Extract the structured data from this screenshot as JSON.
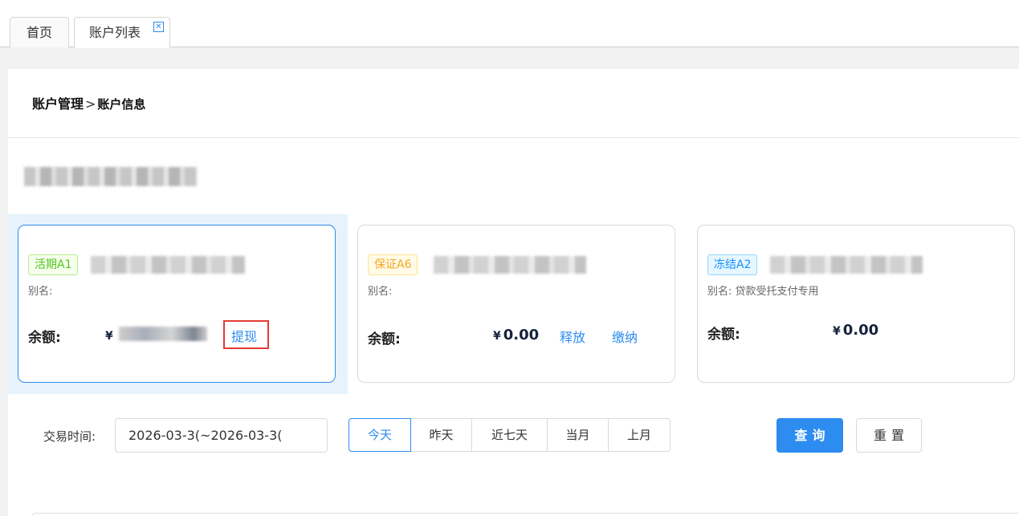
{
  "tabs": [
    {
      "label": "首页",
      "active": false
    },
    {
      "label": "账户列表",
      "active": true,
      "close_icon": "close-icon"
    }
  ],
  "breadcrumb": {
    "parent": "账户管理",
    "separator": ">",
    "current": "账户信息"
  },
  "accounts": [
    {
      "badge": "活期A1",
      "badge_color": "#52c41a",
      "alias_label": "别名:",
      "alias": "",
      "balance_label": "余额:",
      "currency": "¥",
      "amount": "",
      "actions": [
        "提现"
      ]
    },
    {
      "badge": "保证A6",
      "badge_color": "#f5a623",
      "alias_label": "别名:",
      "alias": "",
      "balance_label": "余额:",
      "currency": "¥",
      "amount": "0.00",
      "actions": [
        "释放",
        "缴纳"
      ]
    },
    {
      "badge": "冻结A2",
      "badge_color": "#1890ff",
      "alias_label": "别名:",
      "alias": "贷款受托支付专用",
      "balance_label": "余额:",
      "currency": "¥",
      "amount": "0.00",
      "actions": []
    }
  ],
  "filter": {
    "label": "交易时间:",
    "date_range": "2026-03-3(~2026-03-3(",
    "ranges": [
      "今天",
      "昨天",
      "近七天",
      "当月",
      "上月"
    ],
    "selected_range": "今天",
    "query_button": "查询",
    "reset_button": "重置"
  },
  "colors": {
    "accent": "#2d8cf0",
    "highlight_box": "#e53935"
  }
}
